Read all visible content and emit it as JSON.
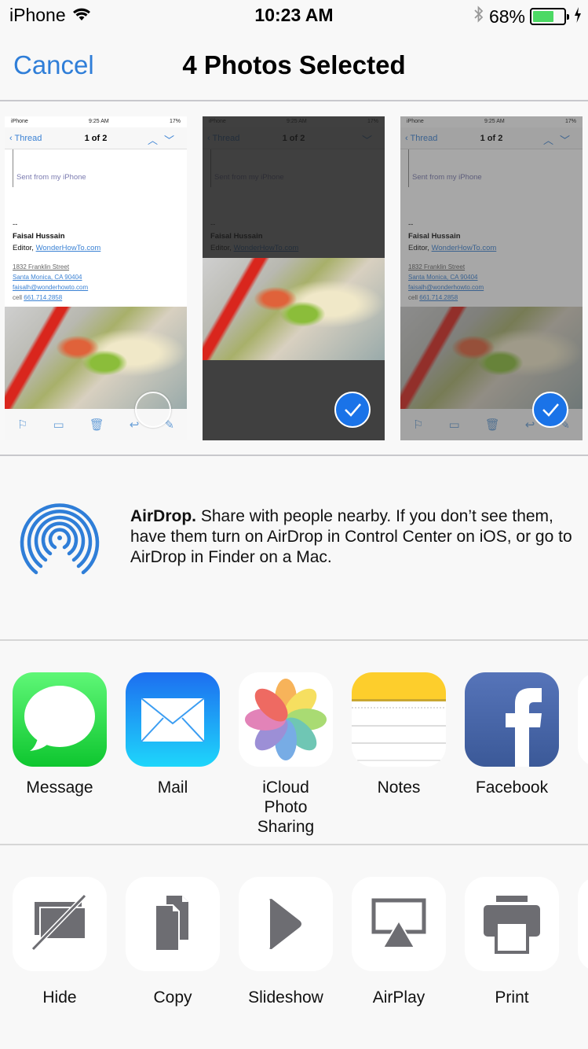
{
  "status_bar": {
    "carrier": "iPhone",
    "time": "10:23 AM",
    "battery_percent_label": "68%",
    "battery_level": 0.68,
    "icons": [
      "wifi-icon",
      "bluetooth-icon",
      "battery-icon",
      "charging-icon"
    ]
  },
  "nav": {
    "cancel_label": "Cancel",
    "title": "4 Photos Selected"
  },
  "thumbnails": [
    {
      "selected": false,
      "status_left": "iPhone",
      "status_time": "9:25 AM",
      "status_battery": "17%",
      "back_label": "Thread",
      "count_label": "1 of 2",
      "quote_text": "Sent from my iPhone",
      "sig_dash": "--",
      "sig_name": "Faisal Hussain",
      "sig_title": "Editor,",
      "sig_site": "WonderHowTo.com",
      "addr_street": "1832 Franklin Street",
      "addr_city": "Santa Monica, CA 90404",
      "addr_email": "faisalh@wonderhowto.com",
      "addr_cell_label": "cell",
      "addr_cell": "661.714.2858"
    },
    {
      "selected": true,
      "status_left": "iPhone",
      "status_time": "9:25 AM",
      "status_battery": "17%",
      "back_label": "Thread",
      "count_label": "1 of 2",
      "quote_text": "Sent from my iPhone",
      "sig_dash": "--",
      "sig_name": "Faisal Hussain",
      "sig_title": "Editor,",
      "sig_site": "WonderHowTo.com"
    },
    {
      "selected": true,
      "status_left": "iPhone",
      "status_time": "9:25 AM",
      "status_battery": "17%",
      "back_label": "Thread",
      "count_label": "1 of 2",
      "quote_text": "Sent from my iPhone",
      "sig_dash": "--",
      "sig_name": "Faisal Hussain",
      "sig_title": "Editor,",
      "sig_site": "WonderHowTo.com",
      "addr_street": "1832 Franklin Street",
      "addr_city": "Santa Monica, CA 90404",
      "addr_email": "faisalh@wonderhowto.com",
      "addr_cell_label": "cell",
      "addr_cell": "661.714.2858"
    }
  ],
  "airdrop": {
    "title": "AirDrop.",
    "description": " Share with people nearby. If you don’t see them, have them turn on AirDrop in Control Center on iOS, or go to AirDrop in Finder on a Mac.",
    "accent_color": "#2f7ed8"
  },
  "share_apps": [
    {
      "label": "Message",
      "icon": "message-icon"
    },
    {
      "label": "Mail",
      "icon": "mail-icon"
    },
    {
      "label": "iCloud\nPhoto Sharing",
      "label_line1": "iCloud",
      "label_line2": "Photo Sharing",
      "icon": "photos-icon"
    },
    {
      "label": "Notes",
      "icon": "notes-icon"
    },
    {
      "label": "Facebook",
      "icon": "facebook-icon"
    }
  ],
  "actions": [
    {
      "label": "Hide",
      "icon": "hide-icon"
    },
    {
      "label": "Copy",
      "icon": "copy-icon"
    },
    {
      "label": "Slideshow",
      "icon": "slideshow-icon"
    },
    {
      "label": "AirPlay",
      "icon": "airplay-icon"
    },
    {
      "label": "Print",
      "icon": "print-icon"
    }
  ],
  "colors": {
    "ios_blue": "#2f7ed8",
    "check_blue": "#1a73e8",
    "action_gray": "#6d6d72",
    "battery_green": "#4cd964"
  }
}
